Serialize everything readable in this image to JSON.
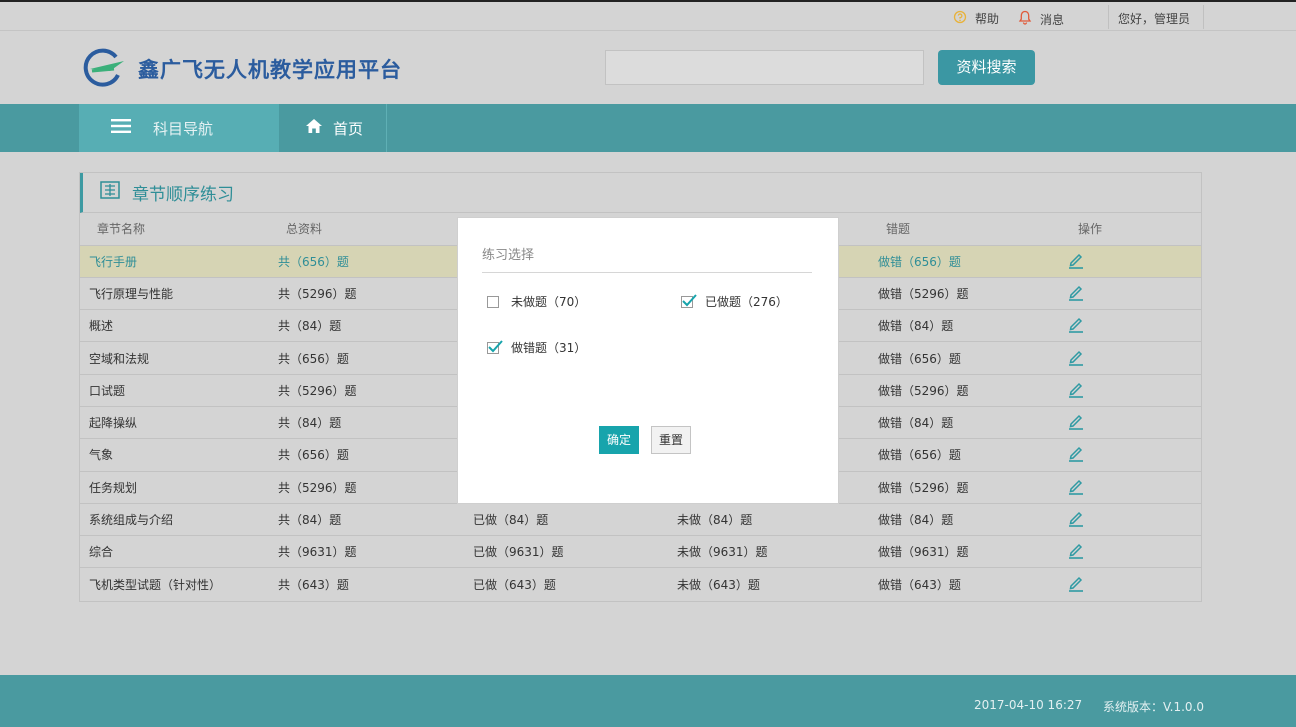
{
  "topbar": {
    "help_label": "帮助",
    "message_label": "消息",
    "greeting": "您好，管理员"
  },
  "header": {
    "title": "鑫广飞无人机教学应用平台",
    "search_placeholder": "",
    "search_button": "资料搜索"
  },
  "nav": {
    "subjects_label": "科目导航",
    "home_label": "首页"
  },
  "panel": {
    "title": "章节顺序练习",
    "columns": [
      "章节名称",
      "总资料",
      "",
      "",
      "错题",
      "操作"
    ],
    "rows": [
      {
        "name": "飞行手册",
        "total": "共（656）题",
        "done": "",
        "undone": "",
        "wrong": "做错（656）题"
      },
      {
        "name": "飞行原理与性能",
        "total": "共（5296）题",
        "done": "",
        "undone": "",
        "wrong": "做错（5296）题"
      },
      {
        "name": "概述",
        "total": "共（84）题",
        "done": "",
        "undone": "",
        "wrong": "做错（84）题"
      },
      {
        "name": "空域和法规",
        "total": "共（656）题",
        "done": "",
        "undone": "",
        "wrong": "做错（656）题"
      },
      {
        "name": "口试题",
        "total": "共（5296）题",
        "done": "",
        "undone": "",
        "wrong": "做错（5296）题"
      },
      {
        "name": "起降操纵",
        "total": "共（84）题",
        "done": "",
        "undone": "",
        "wrong": "做错（84）题"
      },
      {
        "name": "气象",
        "total": "共（656）题",
        "done": "",
        "undone": "",
        "wrong": "做错（656）题"
      },
      {
        "name": "任务规划",
        "total": "共（5296）题",
        "done": "",
        "undone": "",
        "wrong": "做错（5296）题"
      },
      {
        "name": "系统组成与介绍",
        "total": "共（84）题",
        "done": "已做（84）题",
        "undone": "未做（84）题",
        "wrong": "做错（84）题"
      },
      {
        "name": "综合",
        "total": "共（9631）题",
        "done": "已做（9631）题",
        "undone": "未做（9631）题",
        "wrong": "做错（9631）题"
      },
      {
        "name": "飞机类型试题（针对性）",
        "total": "共（643）题",
        "done": "已做（643）题",
        "undone": "未做（643）题",
        "wrong": "做错（643）题"
      }
    ]
  },
  "dialog": {
    "title": "练习选择",
    "options": [
      {
        "label": "未做题（70）",
        "checked": false
      },
      {
        "label": "已做题（276）",
        "checked": true
      },
      {
        "label": "做错题（31）",
        "checked": true
      }
    ],
    "ok_label": "确定",
    "reset_label": "重置"
  },
  "footer": {
    "datetime": "2017-04-10  16:27",
    "version": "系统版本：V.1.0.0"
  },
  "colors": {
    "accent": "#4a9aa0",
    "accent_dark": "#2f8e97",
    "button": "#17a4ac"
  }
}
